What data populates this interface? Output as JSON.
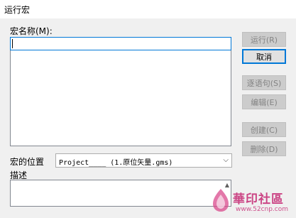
{
  "window": {
    "title": "运行宏"
  },
  "macro_name": {
    "label": "宏名称(M):",
    "value": ""
  },
  "buttons": {
    "run": "运行(R)",
    "cancel": "取消",
    "step": "逐语句(S)",
    "edit": "编辑(E)",
    "create": "创建(C)",
    "delete": "删除(D)"
  },
  "location": {
    "label": "宏的位置",
    "selected": "Project____ (1.原位矢量.gms)"
  },
  "description": {
    "label": "描述",
    "value": ""
  },
  "watermark": {
    "name": "華印社區",
    "url": "www.52cnp.com"
  },
  "colors": {
    "focus_border": "#0078d7",
    "disabled_text": "#838383",
    "watermark": "#c8337a"
  }
}
